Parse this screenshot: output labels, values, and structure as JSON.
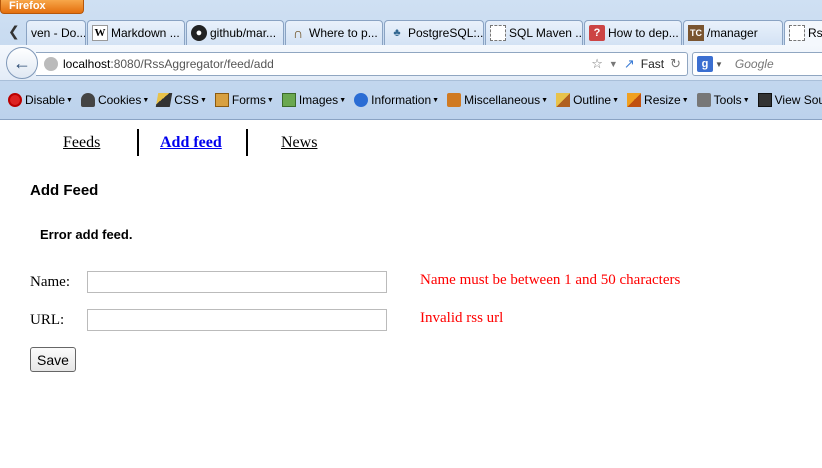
{
  "browser": {
    "app_button": "Firefox",
    "tabs": [
      {
        "label": "ven - Do...",
        "icon": "none"
      },
      {
        "label": "Markdown ...",
        "icon": "wikipedia-icon"
      },
      {
        "label": "github/mar...",
        "icon": "github-icon"
      },
      {
        "label": "Where to p...",
        "icon": "horseshoe-icon"
      },
      {
        "label": "PostgreSQL:...",
        "icon": "postgresql-icon"
      },
      {
        "label": "SQL Maven ...",
        "icon": "blank-page-icon"
      },
      {
        "label": "How to dep...",
        "icon": "help-icon"
      },
      {
        "label": "/manager",
        "icon": "tomcat-icon"
      },
      {
        "label": "Rs",
        "icon": "blank-page-icon"
      }
    ],
    "url_host": "localhost",
    "url_rest": ":8080/RssAggregator/feed/add",
    "fast_label": "Fast",
    "search_placeholder": "Google",
    "devbar": [
      {
        "label": "Disable",
        "icon": "disable-icon"
      },
      {
        "label": "Cookies",
        "icon": "cookies-icon"
      },
      {
        "label": "CSS",
        "icon": "css-icon"
      },
      {
        "label": "Forms",
        "icon": "forms-icon"
      },
      {
        "label": "Images",
        "icon": "images-icon"
      },
      {
        "label": "Information",
        "icon": "information-icon"
      },
      {
        "label": "Miscellaneous",
        "icon": "miscellaneous-icon"
      },
      {
        "label": "Outline",
        "icon": "outline-icon"
      },
      {
        "label": "Resize",
        "icon": "resize-icon"
      },
      {
        "label": "Tools",
        "icon": "tools-icon"
      },
      {
        "label": "View Source",
        "icon": "view-source-icon"
      }
    ]
  },
  "page": {
    "menu": {
      "feeds": "Feeds",
      "add_feed": "Add feed",
      "news": "News"
    },
    "heading": "Add Feed",
    "error": "Error add feed.",
    "form": {
      "name_label": "Name:",
      "name_value": "",
      "name_error": "Name must be between 1 and 50 characters",
      "url_label": "URL:",
      "url_value": "",
      "url_error": "Invalid rss url",
      "save_label": "Save"
    }
  }
}
